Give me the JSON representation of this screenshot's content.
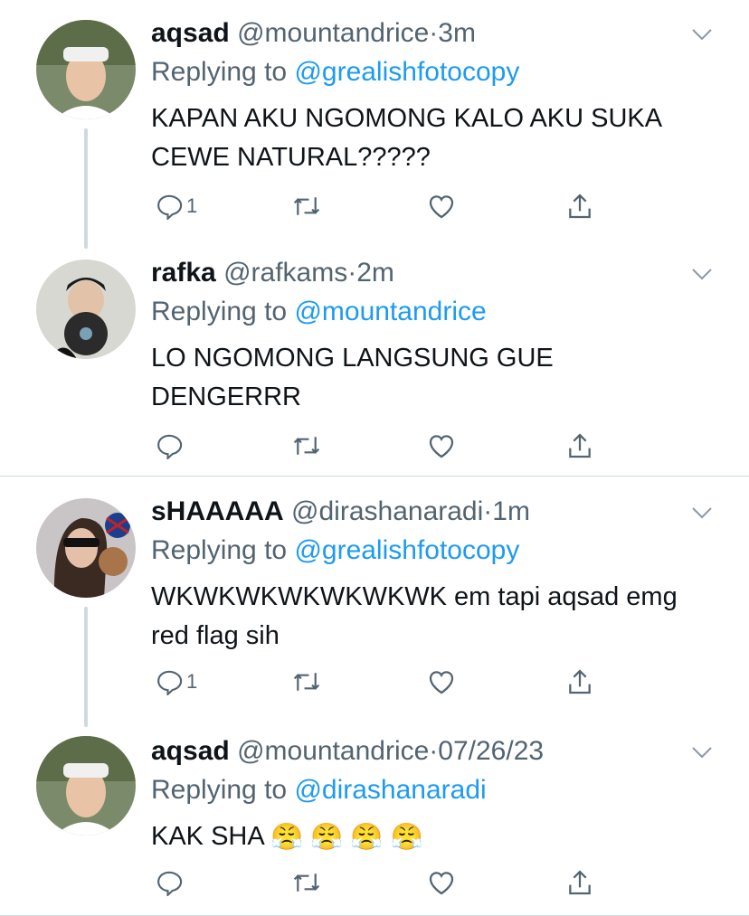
{
  "tweets": [
    {
      "name": "aqsad",
      "handle": "@mountandrice",
      "sep": "·",
      "time": "3m",
      "replying_prefix": "Replying to",
      "replying_to": "@grealishfotocopy",
      "text": "KAPAN AKU NGOMONG KALO AKU SUKA CEWE NATURAL?????",
      "reply_count": "1"
    },
    {
      "name": "rafka",
      "handle": "@rafkams",
      "sep": "·",
      "time": "2m",
      "replying_prefix": "Replying to",
      "replying_to": "@mountandrice",
      "text": "LO NGOMONG LANGSUNG GUE DENGERRR",
      "reply_count": ""
    },
    {
      "name": "sHAAAAA",
      "handle": "@dirashanaradi",
      "sep": "·",
      "time": "1m",
      "replying_prefix": "Replying to",
      "replying_to": "@grealishfotocopy",
      "text": "WKWKWKWKWKWKWK em tapi aqsad emg red flag sih",
      "reply_count": "1"
    },
    {
      "name": "aqsad",
      "handle": "@mountandrice",
      "sep": "·",
      "time": "07/26/23",
      "replying_prefix": "Replying to",
      "replying_to": "@dirashanaradi",
      "text": "KAK SHA",
      "reply_count": "",
      "emoji": [
        "😤",
        "😤",
        "😤",
        "😤"
      ]
    }
  ],
  "icons": {
    "reply": "reply-icon",
    "retweet": "retweet-icon",
    "like": "heart-icon",
    "share": "share-icon",
    "more": "chevron-down-icon"
  },
  "colors": {
    "link": "#1d9bf0",
    "secondary_text": "#536471",
    "thread_line": "#cfd9de"
  }
}
